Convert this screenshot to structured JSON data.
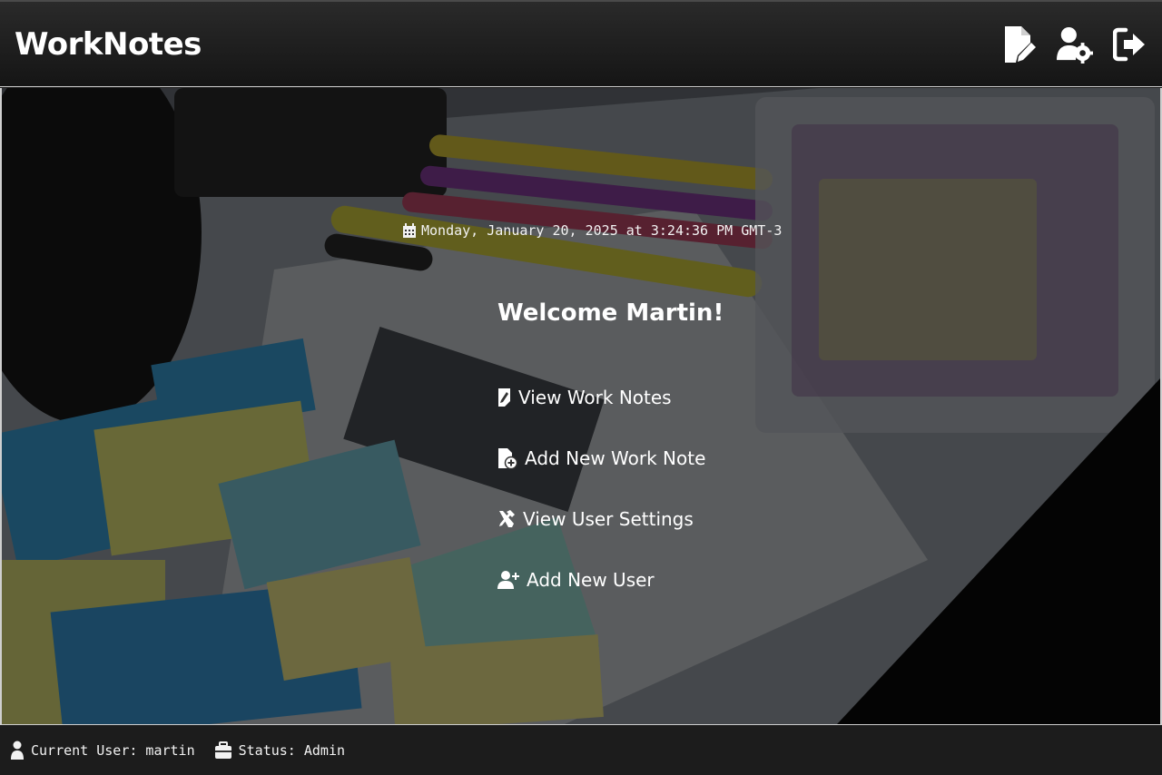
{
  "header": {
    "brand": "WorkNotes",
    "actions": [
      {
        "icon": "file-edit-icon"
      },
      {
        "icon": "user-gear-icon"
      },
      {
        "icon": "logout-icon"
      }
    ]
  },
  "main": {
    "datetime": "Monday, January 20, 2025 at 3:24:36 PM GMT-3",
    "welcome": "Welcome Martin!",
    "menu": [
      {
        "label": "View Work Notes",
        "icon": "note-icon"
      },
      {
        "label": "Add New Work Note",
        "icon": "file-add-icon"
      },
      {
        "label": "View User Settings",
        "icon": "tools-icon"
      },
      {
        "label": "Add New User",
        "icon": "user-plus-icon"
      }
    ]
  },
  "footer": {
    "current_user": "Current User: martin",
    "status": "Status: Admin"
  },
  "colors": {
    "header_bg": "#1e1e1e",
    "text": "#ffffff",
    "footer_bg": "#1c1c1c"
  }
}
